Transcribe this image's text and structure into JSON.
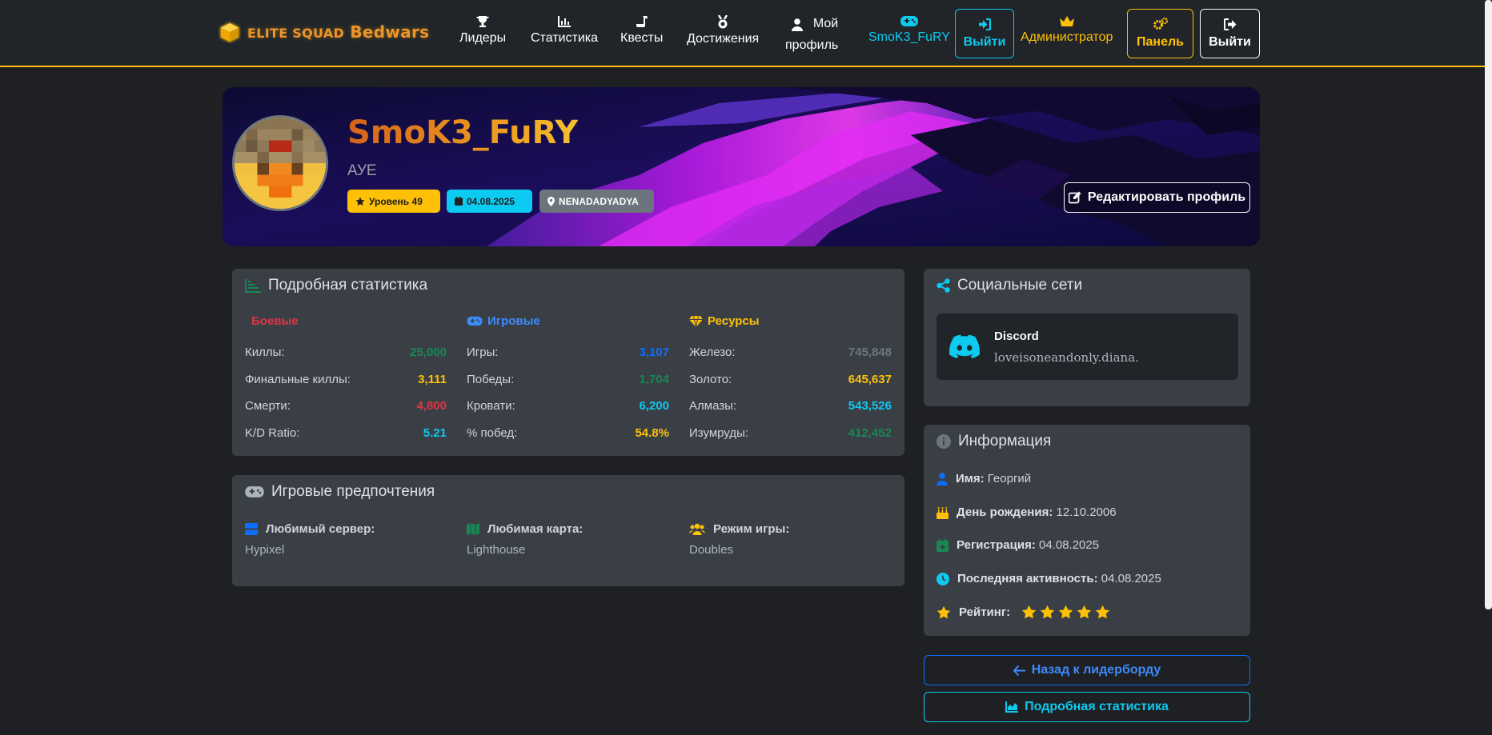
{
  "navbar": {
    "brand_small": "ELITE SQUAD",
    "brand_big": "Bedwars",
    "items": [
      {
        "label": "Лидеры",
        "icon": "trophy-icon"
      },
      {
        "label": "Статистика",
        "icon": "chart-icon"
      },
      {
        "label": "Квесты",
        "icon": "scroll-icon"
      },
      {
        "label": "Достижения",
        "icon": "medal-icon"
      },
      {
        "label_line1": "Мой",
        "label_line2": "профиль",
        "icon": "user-icon"
      }
    ],
    "username": "SmoK3_FuRY",
    "login_label": "Выйти",
    "admin_label": "Администратор",
    "panel_label": "Панель",
    "logout_label": "Выйти"
  },
  "profile": {
    "name": "SmoK3_FuRY",
    "status": "АУЕ",
    "level_badge": "Уровень 49",
    "date_badge": "04.08.2025",
    "location_badge": "NENADADYADYA",
    "edit_label": "Редактировать профиль"
  },
  "stats": {
    "title": "Подробная статистика",
    "combat": {
      "title": "Боевые",
      "rows": [
        {
          "label": "Киллы:",
          "value": "25,000"
        },
        {
          "label": "Финальные киллы:",
          "value": "3,111"
        },
        {
          "label": "Смерти:",
          "value": "4,800"
        },
        {
          "label": "K/D Ratio:",
          "value": "5.21"
        }
      ]
    },
    "game": {
      "title": "Игровые",
      "rows": [
        {
          "label": "Игры:",
          "value": "3,107"
        },
        {
          "label": "Победы:",
          "value": "1,704"
        },
        {
          "label": "Кровати:",
          "value": "6,200"
        },
        {
          "label": "% побед:",
          "value": "54.8%"
        }
      ]
    },
    "resources": {
      "title": "Ресурсы",
      "rows": [
        {
          "label": "Железо:",
          "value": "745,848"
        },
        {
          "label": "Золото:",
          "value": "645,637"
        },
        {
          "label": "Алмазы:",
          "value": "543,526"
        },
        {
          "label": "Изумруды:",
          "value": "412,452"
        }
      ]
    }
  },
  "preferences": {
    "title": "Игровые предпочтения",
    "server_label": "Любимый сервер:",
    "server_value": "Hypixel",
    "map_label": "Любимая карта:",
    "map_value": "Lighthouse",
    "mode_label": "Режим игры:",
    "mode_value": "Doubles"
  },
  "social": {
    "title": "Социальные сети",
    "discord_label": "Discord",
    "discord_value": "loveisoneandonly.diana."
  },
  "info": {
    "title": "Информация",
    "name_label": "Имя:",
    "name_value": "Георгий",
    "birthday_label": "День рождения:",
    "birthday_value": "12.10.2006",
    "registration_label": "Регистрация:",
    "registration_value": "04.08.2025",
    "activity_label": "Последняя активность:",
    "activity_value": "04.08.2025",
    "rating_label": "Рейтинг:",
    "rating_stars": 5
  },
  "buttons": {
    "back_label": "Назад к лидерборду",
    "detail_label": "Подробная статистика"
  },
  "colors": {
    "accent": "#ffc107",
    "cyan": "#0dcaf0",
    "blue": "#0d6efd",
    "green": "#198754",
    "red": "#dc3545",
    "gray": "#6c757d"
  }
}
